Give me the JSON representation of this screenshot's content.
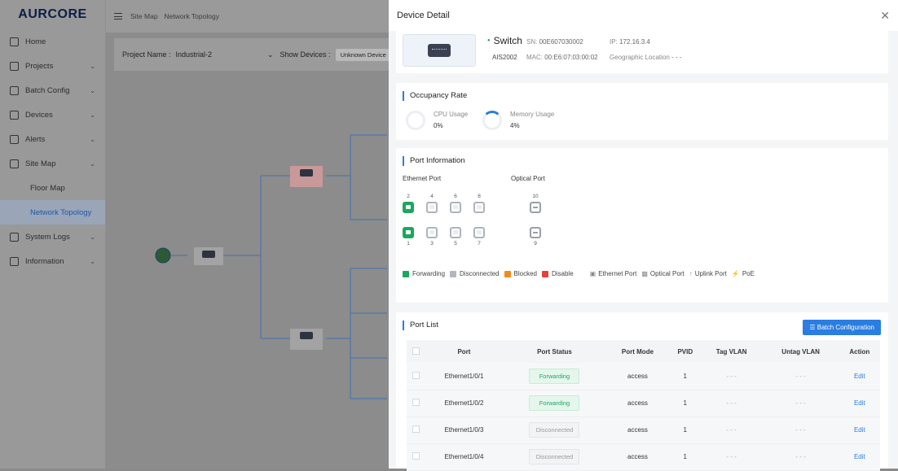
{
  "app": {
    "logo": "AURCORE",
    "breadcrumb": [
      "Site Map",
      "Network Topology"
    ],
    "sidebar": [
      {
        "label": "Home",
        "icon": "home-icon",
        "chevron": false
      },
      {
        "label": "Projects",
        "icon": "projects-icon",
        "chevron": true
      },
      {
        "label": "Batch Config",
        "icon": "batch-config-icon",
        "chevron": true
      },
      {
        "label": "Devices",
        "icon": "devices-icon",
        "chevron": true
      },
      {
        "label": "Alerts",
        "icon": "alerts-icon",
        "chevron": true
      },
      {
        "label": "Site Map",
        "icon": "site-map-icon",
        "chevron": true
      },
      {
        "label": "Floor Map",
        "sub": true
      },
      {
        "label": "Network Topology",
        "sub": true,
        "active": true
      },
      {
        "label": "System Logs",
        "icon": "system-logs-icon",
        "chevron": true
      },
      {
        "label": "Information",
        "icon": "information-icon",
        "chevron": true
      }
    ],
    "filter": {
      "project_label": "Project Name :",
      "project_value": "Industrial-2",
      "show_label": "Show Devices :",
      "show_value": "Unknown Device"
    }
  },
  "drawer": {
    "title": "Device Detail",
    "device": {
      "type": "Switch",
      "model": "AIS2002",
      "sn_label": "SN:",
      "sn": "00E607030002",
      "mac_label": "MAC:",
      "mac": "00:E6:07:03:00:02",
      "ip_label": "IP:",
      "ip": "172.16.3.4",
      "geo_label": "Geographic Location",
      "geo": "- - -"
    },
    "occupancy": {
      "title": "Occupancy Rate",
      "cpu_label": "CPU Usage",
      "cpu": "0%",
      "mem_label": "Memory Usage",
      "mem": "4%"
    },
    "ports": {
      "title": "Port Information",
      "eth_label": "Ethernet Port",
      "opt_label": "Optical Port",
      "top_row": [
        {
          "n": "2",
          "s": "fw"
        },
        {
          "n": "4",
          "s": "dc"
        },
        {
          "n": "6",
          "s": "dc"
        },
        {
          "n": "8",
          "s": "dc"
        }
      ],
      "bottom_row": [
        {
          "n": "1",
          "s": "fw"
        },
        {
          "n": "3",
          "s": "dc"
        },
        {
          "n": "5",
          "s": "dc"
        },
        {
          "n": "7",
          "s": "dc"
        }
      ],
      "opt_top": "10",
      "opt_bottom": "9",
      "legend": [
        {
          "label": "Forwarding",
          "color": "#1aa85c"
        },
        {
          "label": "Disconnected",
          "color": "#b3b6bc"
        },
        {
          "label": "Blocked",
          "color": "#f28a1a"
        },
        {
          "label": "Disable",
          "color": "#e5403a"
        }
      ],
      "legend2": [
        "Ethernet Port",
        "Optical Port",
        "Uplink Port",
        "PoE"
      ]
    },
    "port_list": {
      "title": "Port List",
      "batch_label": "Batch Configuration",
      "columns": [
        "Port",
        "Port Status",
        "Port Mode",
        "PVID",
        "Tag VLAN",
        "Untag VLAN",
        "Action"
      ],
      "rows": [
        {
          "port": "Ethernet1/0/1",
          "status": "Forwarding",
          "mode": "access",
          "pvid": "1",
          "tag": "- - -",
          "untag": "- - -",
          "action": "Edit"
        },
        {
          "port": "Ethernet1/0/2",
          "status": "Forwarding",
          "mode": "access",
          "pvid": "1",
          "tag": "- - -",
          "untag": "- - -",
          "action": "Edit"
        },
        {
          "port": "Ethernet1/0/3",
          "status": "Disconnected",
          "mode": "access",
          "pvid": "1",
          "tag": "- - -",
          "untag": "- - -",
          "action": "Edit"
        },
        {
          "port": "Ethernet1/0/4",
          "status": "Disconnected",
          "mode": "access",
          "pvid": "1",
          "tag": "- - -",
          "untag": "- - -",
          "action": "Edit"
        }
      ]
    }
  }
}
